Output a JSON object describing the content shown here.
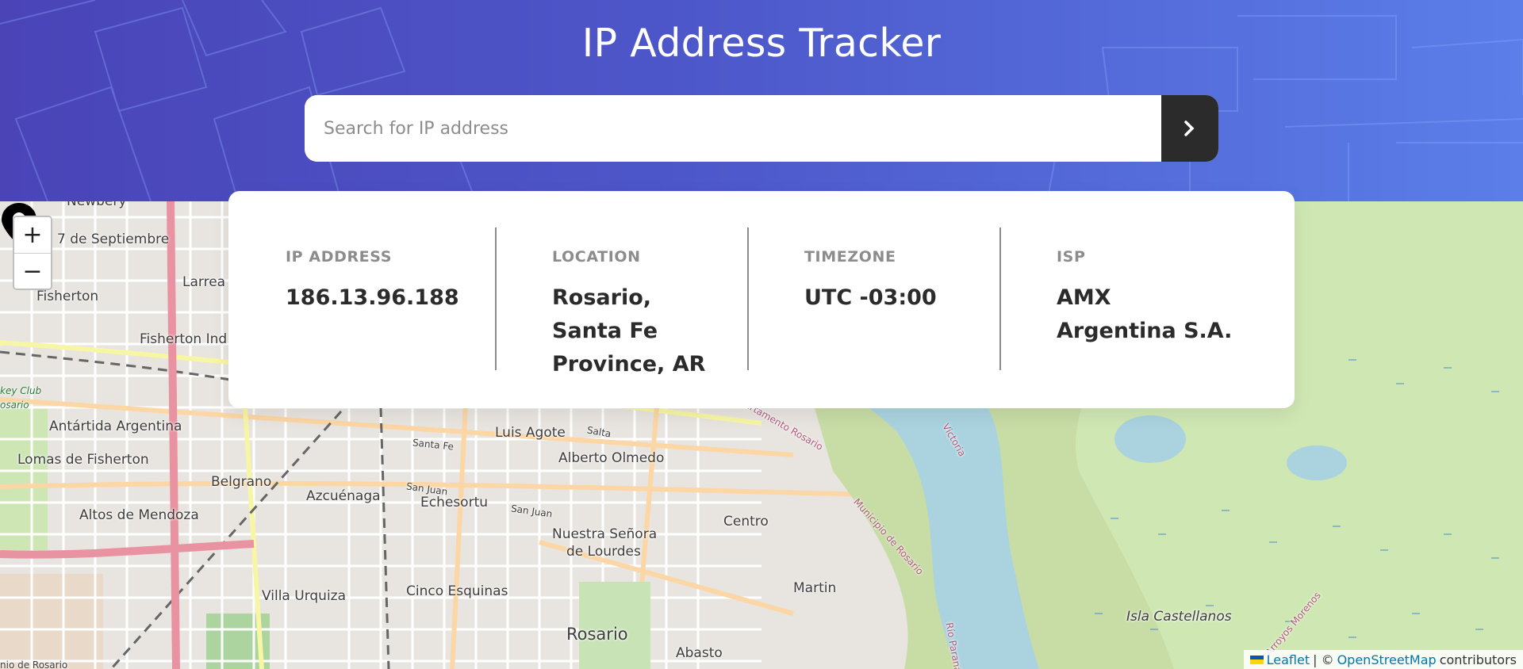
{
  "header": {
    "title": "IP Address Tracker",
    "search_placeholder": "Search for IP address",
    "search_value": "",
    "submit_icon": "chevron-right-icon"
  },
  "info": [
    {
      "label": "IP ADDRESS",
      "value": "186.13.96.188"
    },
    {
      "label": "LOCATION",
      "value": "Rosario, Santa Fe Province, AR"
    },
    {
      "label": "TIMEZONE",
      "value": "UTC -03:00"
    },
    {
      "label": "ISP",
      "value": "AMX Argentina S.A."
    }
  ],
  "map": {
    "zoom_in": "+",
    "zoom_out": "−",
    "places": {
      "newbery": "Newbery",
      "septiembre": "7 de Septiembre",
      "fisherton": "Fisherton",
      "larrea": "Larrea",
      "fisherton_ind": "Fisherton Ind",
      "hockey_club": "key Club",
      "hockey_club2": "osario",
      "antartida": "Antártida Argentina",
      "lomas": "Lomas de Fisherton",
      "belgrano": "Belgrano",
      "altos": "Altos de Mendoza",
      "azcuenaga": "Azcuénaga",
      "echesortu": "Echesortu",
      "luis_agote": "Luis Agote",
      "alberto_olmedo": "Alberto Olmedo",
      "nuestra": "Nuestra Señora",
      "lourdes": "de Lourdes",
      "centro": "Centro",
      "martin": "Martin",
      "villa_urquiza": "Villa Urquiza",
      "cinco_esquinas": "Cinco Esquinas",
      "rosario": "Rosario",
      "abasto": "Abasto",
      "isla": "Isla Castellanos",
      "depto_rosario": "Departamento Rosario",
      "municipio": "Municipio de Rosario",
      "victoria": "Victoria",
      "arroyos": "Arroyos Morenos",
      "rio": "Río Paraná",
      "santa_fe": "Santa Fe",
      "salta": "Salta",
      "san_juan1": "San Juan",
      "san_juan2": "San Juan",
      "bottom_left": "nio de Rosario"
    },
    "attribution": {
      "leaflet": "Leaflet",
      "separator": "| ©",
      "osm": "OpenStreetMap",
      "suffix": "contributors"
    }
  },
  "colors": {
    "header_start": "#4a44b7",
    "header_end": "#5b7ee8",
    "dark": "#2b2b2b",
    "gray": "#8c8c8c",
    "river": "#aad3df",
    "wetland": "#c8dca6"
  }
}
